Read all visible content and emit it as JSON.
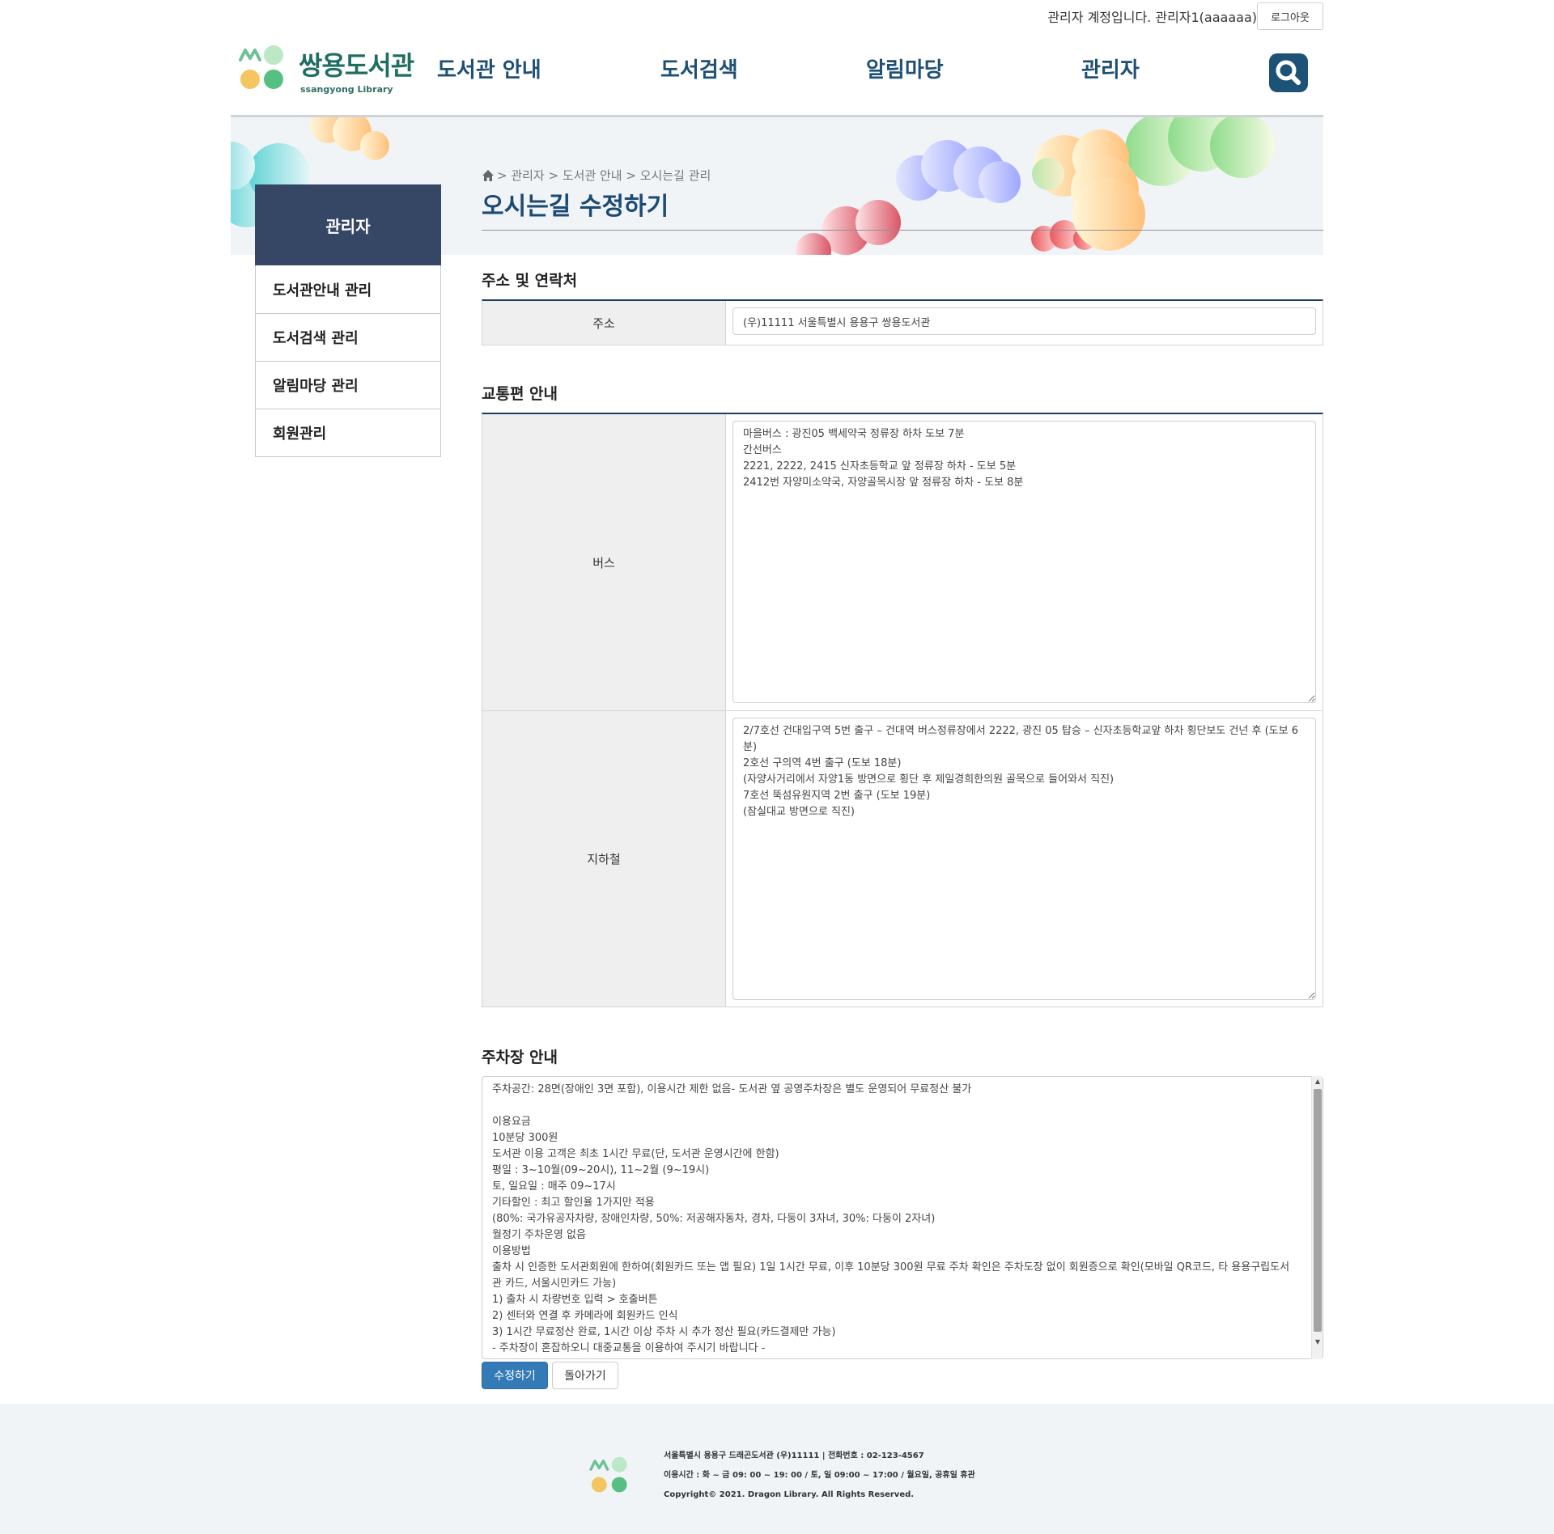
{
  "topbar": {
    "account_text": "관리자 계정입니다. 관리자1(aaaaaa)",
    "logout_label": "로그아웃"
  },
  "header": {
    "logo_title": "쌍용도서관",
    "logo_sub": "ssangyong Library",
    "nav": [
      "도서관 안내",
      "도서검색",
      "알림마당",
      "관리자"
    ],
    "search_icon": "search-icon"
  },
  "sidebar": {
    "title": "관리자",
    "items": [
      "도서관안내 관리",
      "도서검색 관리",
      "알림마당 관리",
      "회원관리"
    ]
  },
  "main": {
    "breadcrumb": "> 관리자 > 도서관 안내 > 오시는길 관리",
    "page_title": "오시는길 수정하기",
    "address_section": {
      "title": "주소 및 연락처",
      "label": "주소",
      "value": "(우)11111 서울특별시 용용구 쌍용도서관"
    },
    "transport_section": {
      "title": "교통편 안내",
      "bus_label": "버스",
      "bus_value": "마을버스 : 광진05 백세약국 정류장 하차 도보 7분\n간선버스\n2221, 2222, 2415 신자초등학교 앞 정류장 하차 - 도보 5분\n2412번 자양미소약국, 자양골목시장 앞 정류장 하차 - 도보 8분",
      "subway_label": "지하철",
      "subway_value": "2/7호선 건대입구역 5번 출구 – 건대역 버스정류장에서 2222, 광진 05 탑승 – 신자초등학교앞 하차 횡단보도 건넌 후 (도보 6분)\n2호선 구의역 4번 출구 (도보 18분)\n(자양사거리에서 자양1동 방면으로 횡단 후 제일경희한의원 골목으로 들어와서 직진)\n7호선 뚝섬유원지역 2번 출구 (도보 19분)\n(잠실대교 방면으로 직진)"
    },
    "parking_section": {
      "title": "주차장 안내",
      "value": "주차공간: 28면(장애인 3면 포함), 이용시간 제한 없음- 도서관 옆 공영주차장은 별도 운영되어 무료정산 불가\n\n이용요금\n10분당 300원\n도서관 이용 고객은 최초 1시간 무료(단, 도서관 운영시간에 한함)\n평일 : 3~10월(09~20시), 11~2월 (9~19시)\n토, 일요일 : 매주 09~17시\n기타할인 : 최고 할인율 1가지만 적용\n(80%: 국가유공자차량, 장애인차량, 50%: 저공해자동차, 경차, 다둥이 3자녀, 30%: 다둥이 2자녀)\n월정기 주차운영 없음\n이용방법\n출차 시 인증한 도서관회원에 한하여(회원카드 또는 앱 필요) 1일 1시간 무료, 이후 10분당 300원 무료 주차 확인은 주차도장 없이 회원증으로 확인(모바일 QR코드, 타 용용구립도서관 카드, 서울시민카드 가능)\n1) 출차 시 차량번호 입력 > 호출버튼\n2) 센터와 연결 후 카메라에 회원카드 인식\n3) 1시간 무료정산 완료, 1시간 이상 주차 시 추가 정산 필요(카드결제만 가능)\n- 주차장이 혼잡하오니 대중교통을 이용하여 주시기 바랍니다 -"
    },
    "buttons": {
      "submit": "수정하기",
      "back": "돌아가기"
    }
  },
  "footer": {
    "line1": "서울특별시 용용구 드래곤도서관 (우)11111 | 전화번호 : 02-123-4567",
    "line2": "이용시간 : 화 ~ 금 09: 00 ~ 19: 00 / 토, 일 09:00 ~ 17:00 / 월요일, 공휴일 휴관",
    "line3": "Copyright© 2021. Dragon Library. All Rights Reserved."
  },
  "colors": {
    "brand_green": "#1f6e62",
    "nav_blue": "#1e4f75",
    "sidebar_header": "#364766",
    "section_rule": "#1c3d63",
    "submit_button": "#337ab7"
  }
}
